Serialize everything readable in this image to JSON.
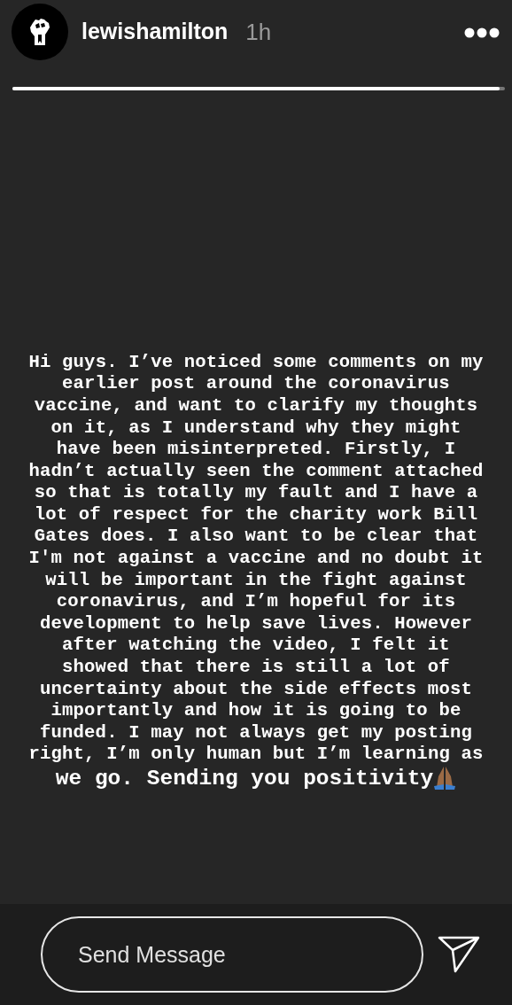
{
  "header": {
    "username": "lewishamilton",
    "time": "1h"
  },
  "progress": [
    {
      "level": 0.99
    }
  ],
  "story_text": {
    "lines": [
      "Hi guys. I’ve noticed some comments on my",
      "earlier post around the coronavirus",
      "vaccine, and want to clarify my thoughts",
      "on it, as I understand why they might",
      "have been misinterpreted. Firstly, I",
      "hadn’t actually seen the comment attached",
      "so that is totally my fault and I have a",
      "lot of respect for the charity work Bill",
      "Gates does. I also want to be clear that",
      "I'm not against a vaccine and no doubt it",
      "will be important in the fight against",
      "coronavirus, and I’m hopeful for its",
      "development to help save lives. However",
      "after watching the video, I felt it",
      "showed that there is still a lot of",
      "uncertainty about the side effects most",
      "importantly and how it is going to be",
      "funded. I may not always get my posting",
      "right, I’m only human but I’m learning as"
    ],
    "closing": "we go. Sending you positivity"
  },
  "reply": {
    "placeholder": "Send Message"
  }
}
